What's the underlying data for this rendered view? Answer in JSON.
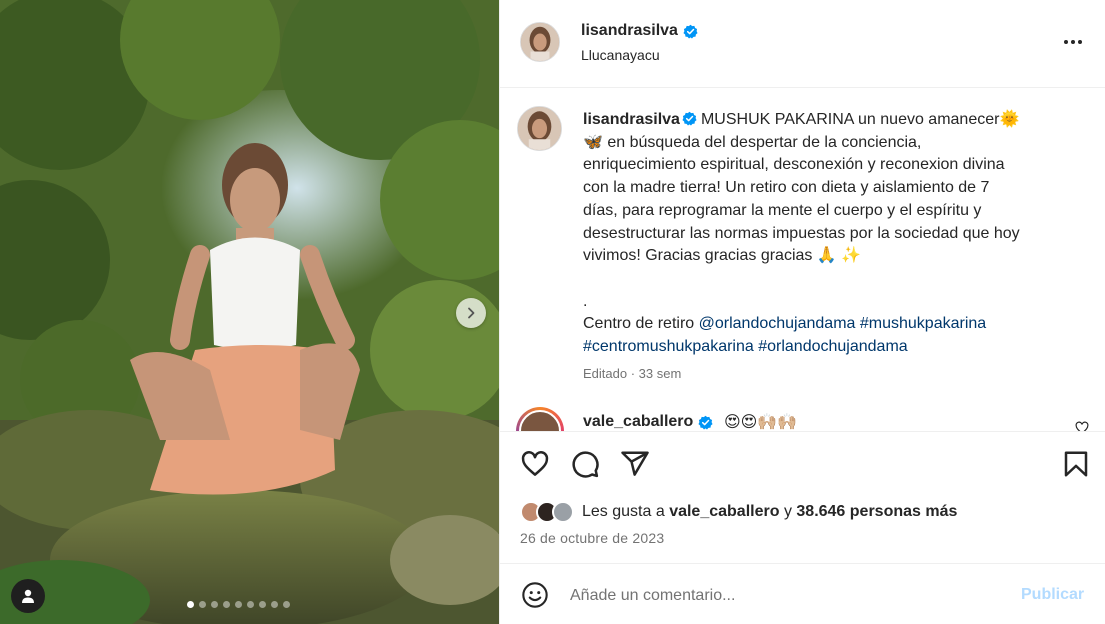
{
  "post": {
    "username": "lisandrasilva",
    "location": "Llucanayacu"
  },
  "caption": {
    "username": "lisandrasilva",
    "lines": [
      "MUSHUK PAKARINA un nuevo amanecer🌞",
      "🦋 en búsqueda del despertar de la conciencia,",
      "enriquecimiento espiritual, desconexión y reconexion divina",
      "con la madre tierra! Un retiro con dieta y aislamiento de 7",
      "días, para reprogramar la mente el cuerpo y el espíritu y",
      "desestructurar las normas impuestas por la sociedad que hoy",
      "vivimos! Gracias gracias gracias 🙏 ✨"
    ],
    "dot": ".",
    "retreat_label": "Centro de retiro",
    "mention_1": "@orlandochujandama",
    "hashtag_1": "#mushukpakarina",
    "hashtag_2": "#centromushukpakarina",
    "mention_2": "#orlandochujandama",
    "meta": "Editado · 33 sem"
  },
  "comment": {
    "username": "vale_caballero",
    "text": "😍😍🙌🏼🙌🏼"
  },
  "likes": {
    "prefix": "Les gusta a",
    "user": "vale_caballero",
    "conjunction": "y",
    "others": "38.646 personas más"
  },
  "date": "26 de octubre de 2023",
  "composer": {
    "placeholder": "Añade un comentario...",
    "publish_label": "Publicar"
  },
  "carousel": {
    "slide_count": 9,
    "active_slide": 1
  },
  "colors": {
    "verified": "#0095f6",
    "link": "#00376b",
    "publish_disabled": "#b3dbff",
    "meta_gray": "#737373"
  }
}
